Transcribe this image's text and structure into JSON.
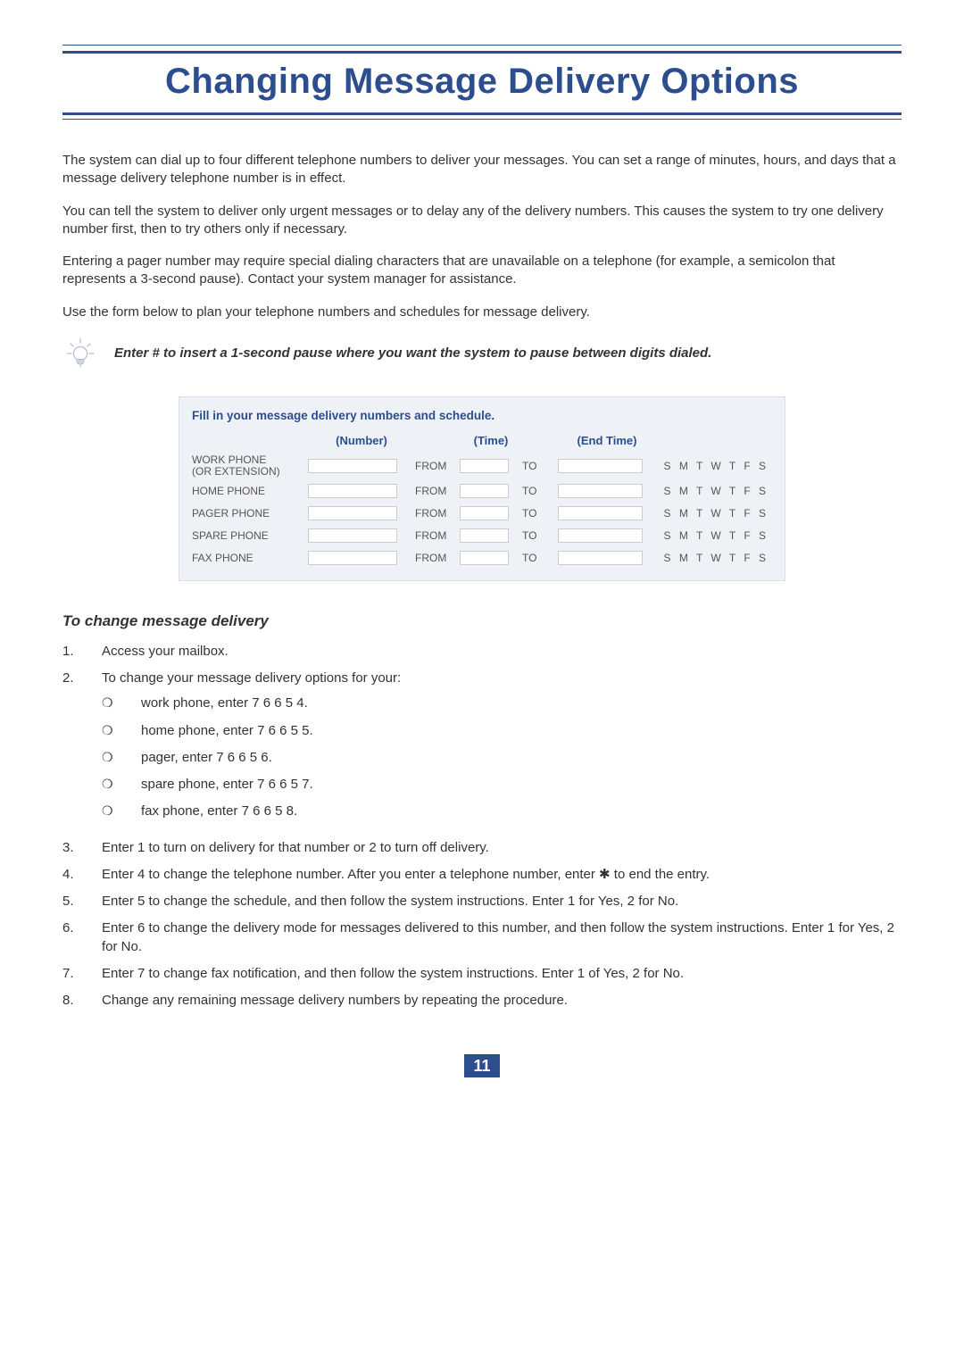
{
  "title": "Changing Message Delivery Options",
  "intro": {
    "p1": "The system can dial up to four different telephone numbers to deliver your messages. You can set a range of minutes, hours, and days that a message delivery telephone number is in effect.",
    "p2": "You can tell the system to deliver only urgent messages or to delay any of the delivery numbers. This causes the system to try one delivery number first, then to try others only if necessary.",
    "p3": "Entering a pager number may require special dialing characters that are unavailable on a telephone (for example, a semicolon that represents a 3-second pause). Contact your system manager for assistance.",
    "p4": "Use the form below to plan your telephone numbers and schedules for message delivery."
  },
  "tip": "Enter # to insert a 1-second pause where you want the system to pause between digits dialed.",
  "form": {
    "title": "Fill in your message delivery numbers and schedule.",
    "headers": {
      "number": "(Number)",
      "time": "(Time)",
      "end": "(End Time)"
    },
    "from": "FROM",
    "to": "TO",
    "days": "S M T W T F S",
    "rows": [
      {
        "label": "WORK PHONE\n(OR EXTENSION)"
      },
      {
        "label": "HOME PHONE"
      },
      {
        "label": "PAGER PHONE"
      },
      {
        "label": "SPARE PHONE"
      },
      {
        "label": "FAX PHONE"
      }
    ]
  },
  "section_heading": "To change message delivery",
  "steps": {
    "s1": "Access your mailbox.",
    "s2_intro": "To change your message delivery options for your:",
    "s2_bullets": [
      "work phone, enter 7 6 6 5 4.",
      "home phone, enter 7 6 6 5 5.",
      "pager, enter 7 6 6 5 6.",
      "spare phone, enter 7 6 6 5 7.",
      "fax phone, enter 7 6 6 5 8."
    ],
    "s3": "Enter 1 to turn on delivery for that number or 2 to turn off delivery.",
    "s4": "Enter 4 to change the telephone number.  After you enter a telephone number, enter ✱ to end the entry.",
    "s5": "Enter 5 to change the schedule, and then follow the system instructions.  Enter 1 for Yes, 2 for No.",
    "s6": "Enter 6 to change the delivery mode for messages delivered to this number, and then follow the system instructions.  Enter 1 for Yes, 2 for No.",
    "s7": "Enter 7 to change fax notification, and then follow the system instructions.  Enter 1 of  Yes, 2 for No.",
    "s8": "Change any remaining message delivery numbers by repeating the procedure."
  },
  "page_number": "11"
}
